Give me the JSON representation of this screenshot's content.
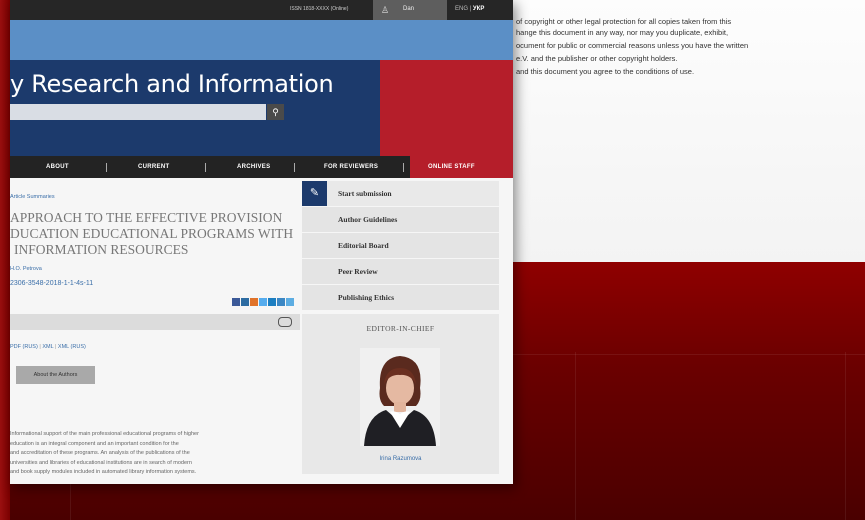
{
  "background_document": {
    "lines": [
      "of copyright or other legal protection for all copies taken from this",
      "hange this document in any way, nor may you duplicate, exhibit,",
      "ocument for public or commercial reasons unless you have the written",
      "e.V. and the publisher or other copyright holders.",
      "and this document you agree to the conditions of use."
    ]
  },
  "topbar": {
    "issn": "ISSN 1818-XXXX (Online)",
    "user_name": "Dan",
    "lang_ukr": "ENG",
    "lang_sep": " | ",
    "lang_active": "УКР"
  },
  "header": {
    "site_title": "y Research and Information",
    "search_placeholder": ""
  },
  "nav": {
    "items": [
      "ABOUT",
      "CURRENT",
      "ARCHIVES",
      "FOR REVIEWERS",
      "ONLINE STAFF"
    ]
  },
  "article": {
    "breadcrumb": "Article Summaries",
    "title_lines": [
      "APPROACH TO THE EFFECTIVE PROVISION",
      "DUCATION EDUCATIONAL PROGRAMS WITH",
      "INFORMATION RESOURCES"
    ],
    "author": "H.O. Petrova",
    "doi": "2306-3548-2018-1-1-4s-11",
    "formats": [
      "PDF (RUS)",
      "XML",
      "XML (RUS)"
    ],
    "format_sep": " | ",
    "about_button": "About the Authors",
    "abstract_lines": [
      "Informational support of the main professional educational programs of higher",
      "education is an integral component and an important condition for the",
      "and accreditation of these programs. An analysis of the publications of the",
      "universities and libraries of educational institutions are in search of modern",
      "and book supply modules included in automated library information systems."
    ]
  },
  "sidebar": {
    "items": [
      "Start submission",
      "Author Guidelines",
      "Editorial Board",
      "Peer Review",
      "Publishing Ethics"
    ]
  },
  "editor": {
    "heading": "EDITOR-IN-CHIEF",
    "name": "Irina Razumova"
  },
  "colors": {
    "header_blue": "#1c3a6c",
    "accent_red": "#b51e2a",
    "strip_blue": "#5b8fc6",
    "link_blue": "#3a6ea8",
    "share_colors": [
      "#3b5998",
      "#2d6ca2",
      "#e0732a",
      "#55acee",
      "#1c7ec1",
      "#3b87c4",
      "#5dade2"
    ]
  }
}
